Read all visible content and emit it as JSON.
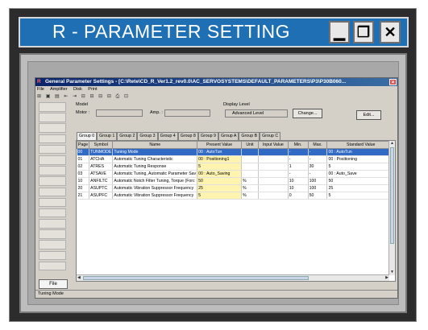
{
  "window": {
    "title": "R - PARAMETER SETTING",
    "min_glyph": "▁",
    "max_glyph": "❐",
    "close_glyph": "✕"
  },
  "inner_window": {
    "title": "General Parameter Settings - [C:\\Rete\\CD_R_Ver1.2_rev0.0\\AC_SERVOSYSTEMS\\DEFAULT_PARAMETERS\\P3\\P30B060...",
    "menu": [
      "File",
      "Amplifier",
      "Disk",
      "Print"
    ],
    "toolbar_glyphs": "⊞ ▣ ▤   ⇤ ⇥   ⊟ ⊟ ⊟ ⊟   ⎙ ⊡",
    "model_label": "Model",
    "motor_label": "Motor :",
    "amp_label": "Amp. :",
    "display_level_label": "Display Level",
    "display_level_value": "Advanced Level",
    "change_button": "Change...",
    "edit_button": "Edit...",
    "file_button": "File",
    "status_text": "Tuning Mode"
  },
  "tabs": [
    "Group 0",
    "Group 1",
    "Group 2",
    "Group 3",
    "Group 4",
    "Group 8",
    "Group 9",
    "Group A",
    "Group B",
    "Group C"
  ],
  "table": {
    "headers": [
      "Page",
      "Symbol",
      "Name",
      "Present Value",
      "Unit",
      "Input Value",
      "Min.",
      "Max.",
      "Standard Value"
    ],
    "rows": [
      {
        "page": "00",
        "symbol": "TUNMODE",
        "name": "Tuning Mode",
        "present": "00 : AutoTun",
        "unit": "",
        "input": "",
        "min": "-",
        "max": "-",
        "std": "00 : AutoTun"
      },
      {
        "page": "01",
        "symbol": "ATCHA",
        "name": "Automatic Tuning Characteristic",
        "present": "00 : Positioning1",
        "unit": "",
        "input": "",
        "min": "-",
        "max": "-",
        "std": "00 : Positioning"
      },
      {
        "page": "02",
        "symbol": "ATRES",
        "name": "Automatic Tuning Response",
        "present": "5",
        "unit": "",
        "input": "",
        "min": "1",
        "max": "30",
        "std": "5"
      },
      {
        "page": "03",
        "symbol": "ATSAVE",
        "name": "Automatic Tuning, Automatic Parameter Sav",
        "present": "00 : Auto_Saving",
        "unit": "",
        "input": "",
        "min": "-",
        "max": "-",
        "std": "00 : Auto_Save"
      },
      {
        "page": "10",
        "symbol": "ANFILTC",
        "name": "Automatic Notch Filter Tuning, Torque (Forc",
        "present": "50",
        "unit": "%",
        "input": "",
        "min": "10",
        "max": "100",
        "std": "50"
      },
      {
        "page": "20",
        "symbol": "ASUPTC",
        "name": "Automatic Vibration Suppressor Frequency",
        "present": "25",
        "unit": "%",
        "input": "",
        "min": "10",
        "max": "100",
        "std": "25"
      },
      {
        "page": "21",
        "symbol": "ASUPFC",
        "name": "Automatic Vibration Suppressor Frequency",
        "present": "5",
        "unit": "%",
        "input": "",
        "min": "0",
        "max": "50",
        "std": "5"
      }
    ]
  }
}
